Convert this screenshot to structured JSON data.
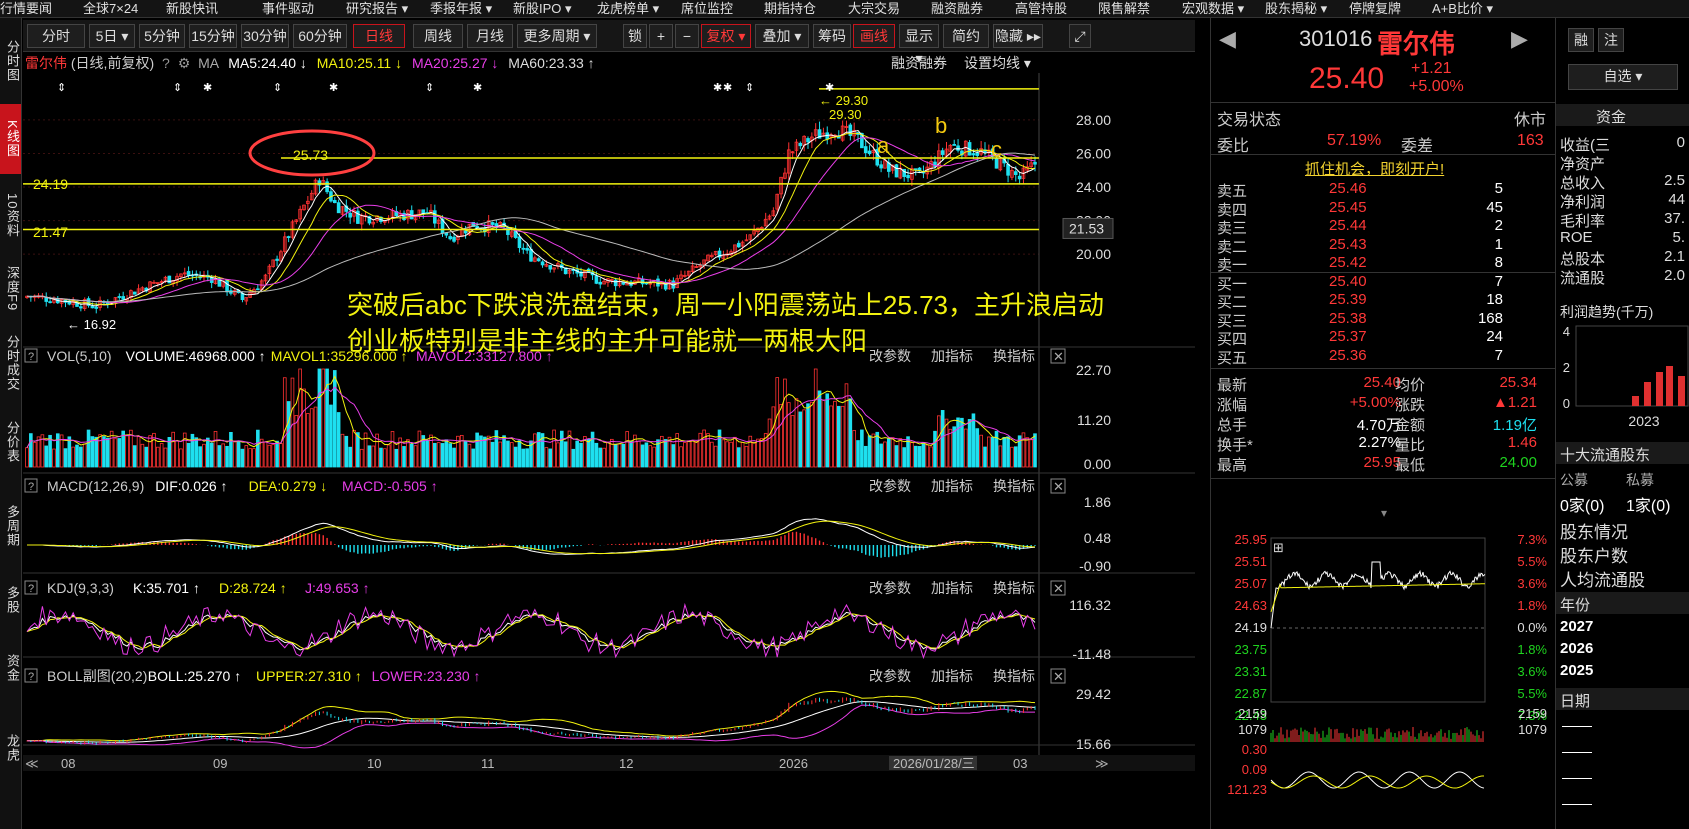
{
  "topnav": [
    "行情要闻",
    "全球7×24",
    "新股快讯",
    "事件驱动",
    "研究报告 ▾",
    "季报年报 ▾",
    "新股IPO ▾",
    "龙虎榜单 ▾",
    "席位监控",
    "期指持仓",
    "大宗交易",
    "融资融券",
    "高管持股",
    "限售解禁",
    "宏观数据 ▾",
    "股东揭秘 ▾",
    "停牌复牌",
    "A+B比价 ▾"
  ],
  "leftbar": [
    "分时图",
    "K线图",
    "10资料",
    "深度F9",
    "分时成交",
    "分价表",
    "多周期",
    "多股",
    "资金",
    "龙虎"
  ],
  "toolbar": {
    "tabs": [
      "分时",
      "5日 ▾",
      "5分钟",
      "15分钟",
      "30分钟",
      "60分钟",
      "日线",
      "周线",
      "月线",
      "更多周期 ▾"
    ],
    "icons": [
      "锁",
      "+",
      "−"
    ],
    "right": [
      "复权 ▾",
      "叠加 ▾",
      "筹码",
      "画线",
      "显示 ▾",
      "简约",
      "隐藏 ▸▸"
    ]
  },
  "stock": {
    "name": "雷尔伟",
    "mode": "(日线,前复权)",
    "code": "301016",
    "price": "25.40",
    "change": "+1.21",
    "pct": "+5.00%"
  },
  "ma": {
    "label": "MA",
    "ma5": "MA5:24.40 ↓",
    "ma10": "MA10:25.11 ↓",
    "ma20": "MA20:25.27 ↓",
    "ma60": "MA60:23.33 ↑",
    "margin": "融资融券",
    "setting": "设置均线 ▾"
  },
  "annot": {
    "line1": "突破后abc下跌浪洗盘结束，周一小阳震荡站上25.73，主升浪启动",
    "line2": "创业板特别是非主线的主升可能就一两根大阳",
    "circle_price": "25.73",
    "level1": "24.19",
    "level2": "21.47",
    "high1": "← 29.30",
    "high2": "29.30",
    "low": "← 16.92",
    "a": "a",
    "b": "b",
    "c": "c",
    "cur": "21.53"
  },
  "price_axis": [
    "28.00",
    "26.00",
    "24.00",
    "22.00",
    "20.00"
  ],
  "vol": {
    "title": "VOL(5,10)",
    "v": "VOLUME:46968.000 ↑",
    "m1": "MAVOL1:35296.000 ↑",
    "m2": "MAVOL2:33127.800 ↑",
    "axis": [
      "22.70",
      "11.20",
      "0.00"
    ]
  },
  "macd": {
    "title": "MACD(12,26,9)",
    "dif": "DIF:0.026 ↑",
    "dea": "DEA:0.279 ↓",
    "macd": "MACD:-0.505 ↑",
    "axis": [
      "1.86",
      "0.48",
      "-0.90"
    ]
  },
  "kdj": {
    "title": "KDJ(9,3,3)",
    "k": "K:35.701 ↑",
    "d": "D:28.724 ↑",
    "j": "J:49.653 ↑",
    "axis": [
      "116.32",
      "-11.48"
    ]
  },
  "boll": {
    "title": "BOLL副图(20,2)",
    "boll": "BOLL:25.270 ↑",
    "upper": "UPPER:27.310 ↑",
    "lower": "LOWER:23.230 ↑",
    "axis": [
      "29.42",
      "15.66"
    ]
  },
  "panel_btns": [
    "改参数",
    "加指标",
    "换指标"
  ],
  "dates": [
    "08",
    "09",
    "10",
    "11",
    "12",
    "2026",
    "2026/01/28/三",
    "03"
  ],
  "right": {
    "trade_status": "交易状态",
    "closed": "休市",
    "webi_l": "委比",
    "webi": "57.19%",
    "weicha_l": "委差",
    "weicha": "163",
    "promo": "抓住机会，即刻开户!",
    "asks": [
      [
        "卖五",
        "25.46",
        "5"
      ],
      [
        "卖四",
        "25.45",
        "45"
      ],
      [
        "卖三",
        "25.44",
        "2"
      ],
      [
        "卖二",
        "25.43",
        "1"
      ],
      [
        "卖一",
        "25.42",
        "8"
      ]
    ],
    "bids": [
      [
        "买一",
        "25.40",
        "7"
      ],
      [
        "买二",
        "25.39",
        "18"
      ],
      [
        "买三",
        "25.38",
        "168"
      ],
      [
        "买四",
        "25.37",
        "24"
      ],
      [
        "买五",
        "25.36",
        "7"
      ]
    ],
    "quote": [
      [
        "最新",
        "25.40",
        "均价",
        "25.34"
      ],
      [
        "涨幅",
        "+5.00%",
        "涨跌",
        "▲1.21"
      ],
      [
        "总手",
        "4.70万",
        "金额",
        "1.19亿"
      ],
      [
        "换手*",
        "2.27%",
        "量比",
        "1.46"
      ],
      [
        "最高",
        "25.95",
        "最低",
        "24.00"
      ]
    ],
    "mini_left": [
      "25.95",
      "25.51",
      "25.07",
      "24.63",
      "24.19",
      "23.75",
      "23.31",
      "22.87",
      "22.43"
    ],
    "mini_right": [
      "7.3%",
      "5.5%",
      "3.6%",
      "1.8%",
      "0.0%",
      "1.8%",
      "3.6%",
      "5.5%",
      "7.3%"
    ],
    "mini_vol": [
      "2159",
      "1079",
      "0.30",
      "0.09",
      "121.23"
    ]
  },
  "far": {
    "btn1": "融",
    "btn2": "注",
    "select": "自选 ▾",
    "tab": "资金",
    "rows": [
      "收益(三",
      "净资产",
      "总收入",
      "净利润",
      "毛利率",
      "ROE",
      "总股本",
      "流通股"
    ],
    "vals": [
      "0",
      "",
      "2.5",
      "44",
      "37.",
      "5.",
      "2.1",
      "2.0"
    ],
    "trend": "利润趋势(千万)",
    "taxis": [
      "4",
      "2",
      "0"
    ],
    "year": "2023",
    "holders": "十大流通股东",
    "pub": "公募",
    "pri": "私募",
    "pubv": "0家(0)",
    "priv": "1家(0)",
    "items": [
      "股东情况",
      "股东户数",
      "人均流通股"
    ],
    "years_h": "年份",
    "years": [
      "2027",
      "2026",
      "2025"
    ],
    "date_h": "日期"
  }
}
